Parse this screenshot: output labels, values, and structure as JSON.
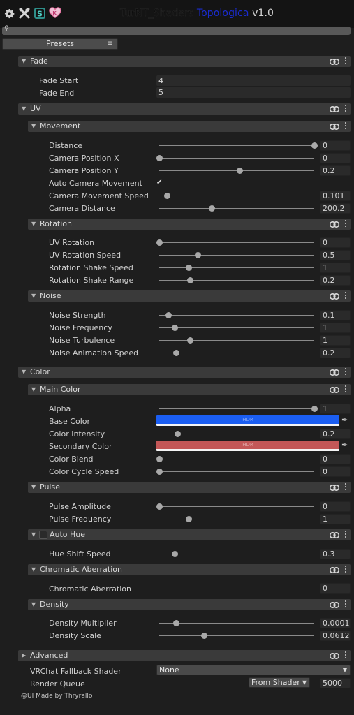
{
  "title": {
    "part1": "TurNT_Shaders ",
    "part2": "Topologica",
    "part3": " v1.0"
  },
  "toolbar_icons": [
    "gear-icon",
    "tools-icon",
    "shader-logo-icon",
    "heart-icon"
  ],
  "presets_label": "Presets",
  "footer": "@UI Made by Thryrallo",
  "colors": {
    "base": "#1b5ef2",
    "secondary": "#c35757",
    "link_icon": "#d8d8d8"
  },
  "sections": {
    "fade": {
      "label": "Fade",
      "fade_start_label": "Fade Start",
      "fade_start": "4",
      "fade_end_label": "Fade End",
      "fade_end": "5"
    },
    "uv": {
      "label": "UV"
    },
    "movement": {
      "label": "Movement",
      "rows": [
        {
          "label": "Distance",
          "value": "0",
          "pos": 1.0
        },
        {
          "label": "Camera Position X",
          "value": "0",
          "pos": 0.0
        },
        {
          "label": "Camera Position Y",
          "value": "0.2",
          "pos": 0.52
        },
        {
          "label": "Auto Camera Movement",
          "checked": true
        },
        {
          "label": "Camera Movement Speed",
          "value": "0.101",
          "pos": 0.05
        },
        {
          "label": "Camera Distance",
          "value": "200.2",
          "pos": 0.34
        }
      ]
    },
    "rotation": {
      "label": "Rotation",
      "rows": [
        {
          "label": "UV Rotation",
          "value": "0",
          "pos": 0.0
        },
        {
          "label": "UV Rotation Speed",
          "value": "0.5",
          "pos": 0.25
        },
        {
          "label": "Rotation Shake Speed",
          "value": "1",
          "pos": 0.19
        },
        {
          "label": "Rotation Shake Range",
          "value": "0.2",
          "pos": 0.2
        }
      ]
    },
    "noise": {
      "label": "Noise",
      "rows": [
        {
          "label": "Noise Strength",
          "value": "0.1",
          "pos": 0.06
        },
        {
          "label": "Noise Frequency",
          "value": "1",
          "pos": 0.1
        },
        {
          "label": "Noise Turbulence",
          "value": "1",
          "pos": 0.2
        },
        {
          "label": "Noise Animation Speed",
          "value": "0.2",
          "pos": 0.11
        }
      ]
    },
    "color": {
      "label": "Color"
    },
    "main_color": {
      "label": "Main Color",
      "alpha_label": "Alpha",
      "alpha": "1",
      "alpha_pos": 1.0,
      "base_label": "Base Color",
      "hdr": "HDR",
      "intensity_label": "Color Intensity",
      "intensity": "0.2",
      "intensity_pos": 0.12,
      "secondary_label": "Secondary Color",
      "blend_label": "Color Blend",
      "blend": "0",
      "blend_pos": 0.0,
      "cycle_label": "Color Cycle Speed",
      "cycle": "0",
      "cycle_pos": 0.0
    },
    "pulse": {
      "label": "Pulse",
      "rows": [
        {
          "label": "Pulse Amplitude",
          "value": "0",
          "pos": 0.0
        },
        {
          "label": "Pulse Frequency",
          "value": "1",
          "pos": 0.19
        }
      ]
    },
    "auto_hue": {
      "label": "Auto Hue",
      "shift_label": "Hue Shift Speed",
      "shift": "0.3",
      "shift_pos": 0.1
    },
    "chromatic": {
      "label": "Chromatic Aberration",
      "row_label": "Chromatic Aberration",
      "value": "0"
    },
    "density": {
      "label": "Density",
      "rows": [
        {
          "label": "Density Multiplier",
          "value": "0.0001",
          "pos": 0.11
        },
        {
          "label": "Density Scale",
          "value": "0.06125",
          "pos": 0.29
        }
      ]
    },
    "advanced": {
      "label": "Advanced"
    }
  },
  "fallback_label": "VRChat Fallback Shader",
  "fallback_value": "None",
  "render_queue_label": "Render Queue",
  "render_queue_mode": "From Shader",
  "render_queue_value": "5000"
}
